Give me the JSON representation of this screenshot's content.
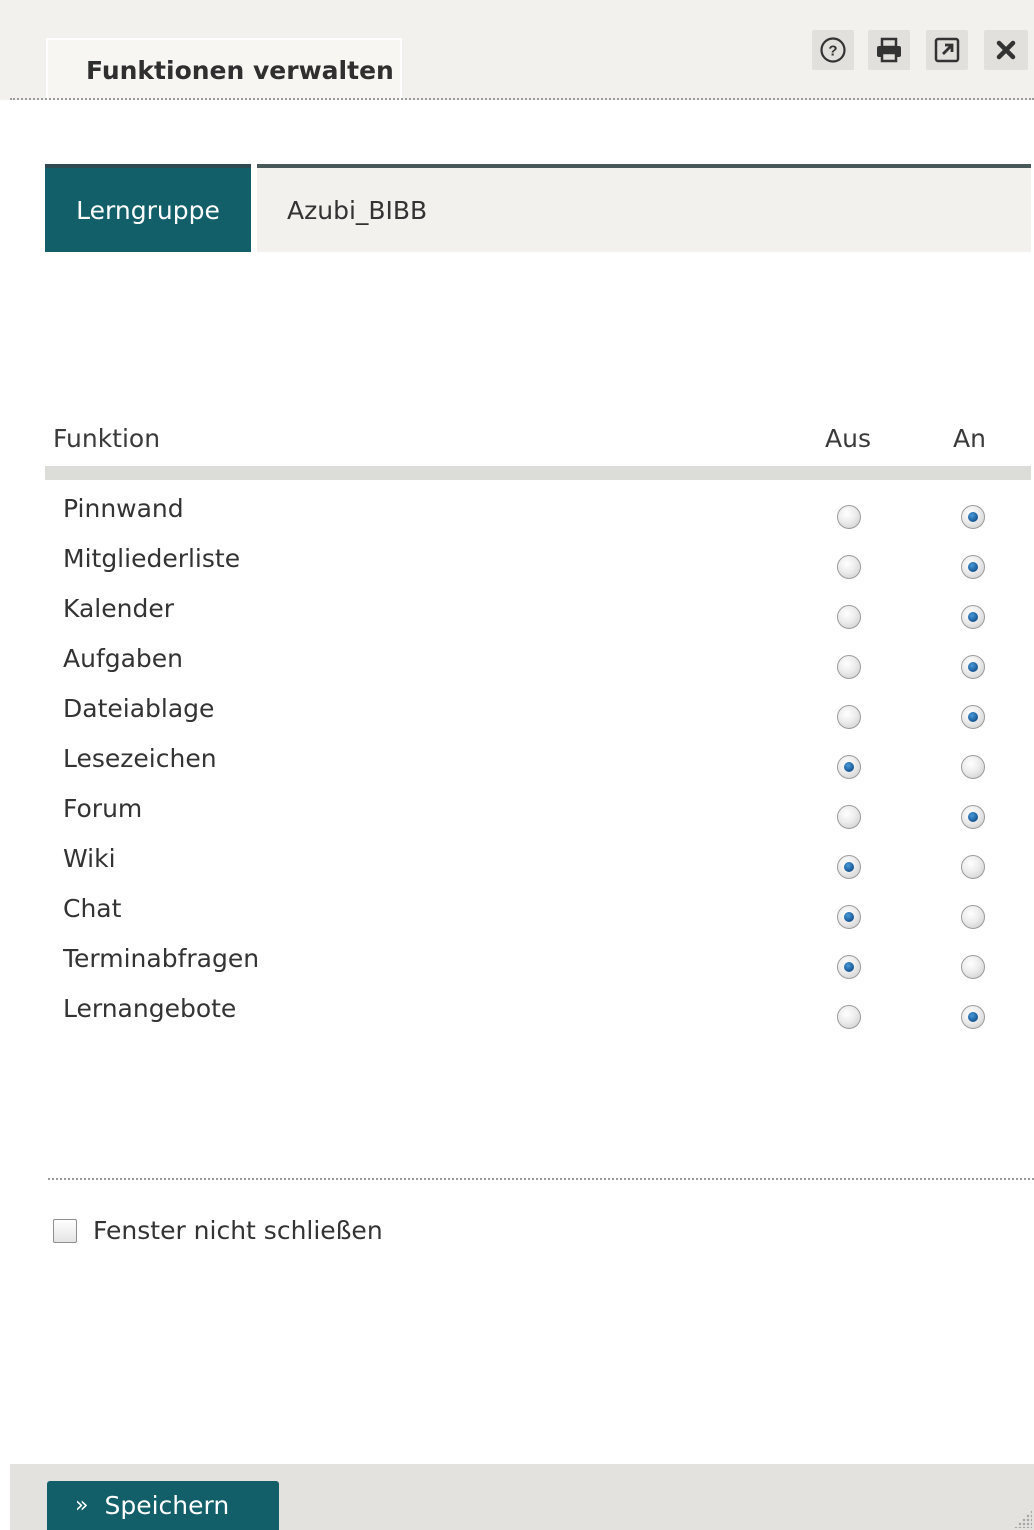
{
  "dialog": {
    "title": "Funktionen verwalten",
    "toolbar": {
      "help_icon": "help-circle-icon",
      "print_icon": "printer-icon",
      "popout_icon": "external-window-icon",
      "close_icon": "close-icon"
    }
  },
  "context": {
    "label": "Lerngruppe",
    "value": "Azubi_BIBB"
  },
  "table": {
    "headers": {
      "function": "Funktion",
      "off": "Aus",
      "on": "An"
    },
    "rows": [
      {
        "name": "Pinnwand",
        "enabled": true
      },
      {
        "name": "Mitgliederliste",
        "enabled": true
      },
      {
        "name": "Kalender",
        "enabled": true
      },
      {
        "name": "Aufgaben",
        "enabled": true
      },
      {
        "name": "Dateiablage",
        "enabled": true
      },
      {
        "name": "Lesezeichen",
        "enabled": false
      },
      {
        "name": "Forum",
        "enabled": true
      },
      {
        "name": "Wiki",
        "enabled": false
      },
      {
        "name": "Chat",
        "enabled": false
      },
      {
        "name": "Terminabfragen",
        "enabled": false
      },
      {
        "name": "Lernangebote",
        "enabled": true
      }
    ]
  },
  "keep_open": {
    "label": "Fenster nicht schließen",
    "checked": false
  },
  "footer": {
    "save_arrow": "»",
    "save_label": "Speichern"
  },
  "colors": {
    "accent": "#125f6a",
    "header_bg": "#f2f1ee",
    "footer_bg": "#e3e2de"
  }
}
